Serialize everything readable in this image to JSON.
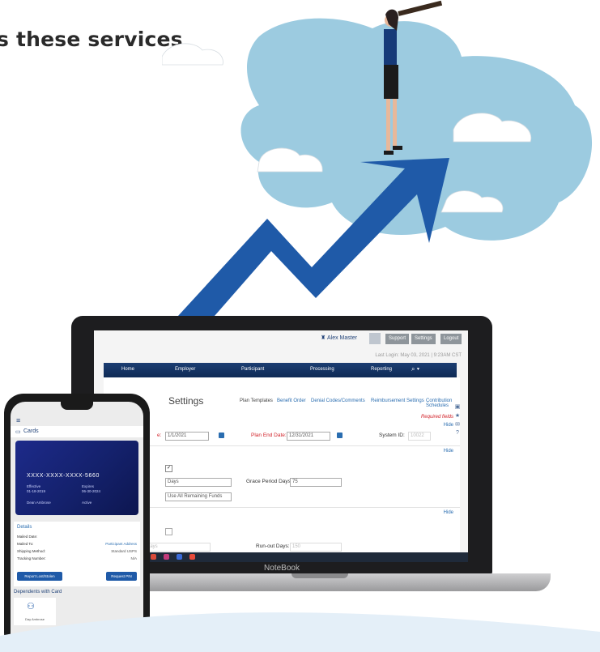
{
  "headline": "s these services",
  "laptop": {
    "brand": "NoteBook",
    "topbar": {
      "user_name": "Alex Master",
      "buttons": [
        "Support",
        "Settings",
        "Logout"
      ],
      "last_login": "Last Login: May 03, 2021 | 9:23AM CST"
    },
    "nav": [
      "Home",
      "Employer",
      "Participant",
      "Processing",
      "Reporting"
    ],
    "page_title": "Settings",
    "tabs": [
      "Plan Templates",
      "Benefit Order",
      "Denial Codes/Comments",
      "Reimbursement Settings",
      "Contribution Schedules"
    ],
    "required_text": "Required fields",
    "hide_label": "Hide",
    "fields": {
      "plan_start_label_fragment": "e:",
      "plan_start_value": "1/1/2021",
      "plan_end_label": "Plan End Date:",
      "plan_end_value": "12/31/2021",
      "system_id_label": "System ID:",
      "system_id_value": "10022",
      "grace_unit_value": "Days",
      "grace_days_label": "Grace Period Days:",
      "grace_days_value": "75",
      "funds_value": "Use All Remaining Funds",
      "runout_unit_value": "Days",
      "runout_label": "Run-out Days:",
      "runout_value": "150"
    }
  },
  "phone": {
    "section_title": "Cards",
    "card": {
      "number": "XXXX-XXXX-XXXX-5660",
      "effective_label": "Effective",
      "effective_value": "01-18-2019",
      "expires_label": "Expires",
      "expires_value": "06-30-2024",
      "holder": "Dean Ambrose",
      "status": "Active"
    },
    "details": {
      "title": "Details",
      "rows": [
        {
          "label": "Mailed Date:",
          "value": ""
        },
        {
          "label": "Mailed To:",
          "value": "Participant Address"
        },
        {
          "label": "Shipping Method:",
          "value": "Standard USPS"
        },
        {
          "label": "Tracking Number:",
          "value": "N/A"
        }
      ],
      "report_button": "Report Lost/Stolen",
      "pin_button": "Request PIN"
    },
    "dependents_title": "Dependents with Card",
    "dependent_name": "Day Ambrose"
  },
  "colors": {
    "navy": "#0e2a55",
    "accent_blue": "#2a6db0",
    "sky": "#9ccbe0",
    "arrow": "#1f5aa8",
    "required_red": "#d2232a"
  }
}
